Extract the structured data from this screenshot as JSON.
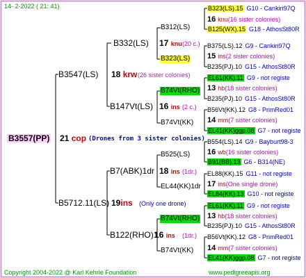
{
  "header": {
    "date": "14-  2-2022 ( 21: 41)"
  },
  "footer": {
    "copyright": "Copyright 2004-2022 @ Karl Kehrle Foundation",
    "site": "www.pedigreeapis.org"
  },
  "root": {
    "code": "B3557(PP)",
    "gen_num": "21",
    "gen_word": "cop",
    "note": "(Drones from 3 sister colonies)"
  },
  "nodes": {
    "b3547": "B3547(LS)",
    "b5712": "B5712.11(LS)",
    "b332": "B332(LS)",
    "b147vt": "B147Vt(LS)",
    "b7abk": "B7(ABK)1dr",
    "b122rho": "B122(RHO)1",
    "b312": "B312(LS)",
    "b323": "B323(LS)",
    "b74vtrho": "B74Vt(RHO)",
    "b74vtkk_a": "B74Vt(KK)",
    "b525": "B525(LS)",
    "el44": "EL44(KK)1dr",
    "b74vtrho2": "B74Vt(RHO)",
    "b74vtkk_b": "B74Vt(KK)"
  },
  "annotations": {
    "n18a": "18",
    "w18a": "krw",
    "c18a": "(26 sister colonies)",
    "n19": "19",
    "w19": "ins",
    "c19": "(Only one drone)",
    "n17": "17",
    "w17": "knu",
    "c17": "(20 c.)",
    "n16": "16",
    "w16": "ins",
    "c16": "(2 c.)",
    "n18b": "18",
    "w18b": "ins",
    "c18b": "(1dr.)",
    "n16b": "16",
    "w16b": "ins",
    "c16b": "(1dr.)"
  },
  "leaves": [
    {
      "kind": "ref",
      "code": "B323(LS).15",
      "hl": "y",
      "tail": "G10 - Cankiri97Q"
    },
    {
      "kind": "info",
      "num": "16",
      "word": "knu",
      "note": "(16 sister colonies)"
    },
    {
      "kind": "ref",
      "code": "B125(WX).15",
      "hl": "y",
      "tail": "G18 - AthosSt80R"
    },
    {
      "kind": "ref",
      "code": "B375(LS).12",
      "hl": "",
      "tail": "G9 - Cankiri97Q"
    },
    {
      "kind": "info",
      "num": "15",
      "word": "ins",
      "note": "(2 sister colonies)"
    },
    {
      "kind": "ref",
      "code": "B235(PJ).10",
      "hl": "",
      "tail": "G15 - AthosSt80R"
    },
    {
      "kind": "ref",
      "code": "EL61(KK).11",
      "hl": "g",
      "tail": "G9 - not registe"
    },
    {
      "kind": "info",
      "num": "13",
      "word": "hb",
      "note": "(18 sister colonies)"
    },
    {
      "kind": "ref",
      "code": "B235(PJ).10",
      "hl": "",
      "tail": "G15 - AthosSt80R"
    },
    {
      "kind": "ref",
      "code": "B56Vt(KK).12",
      "hl": "",
      "tail": "G8 - PrimRed01"
    },
    {
      "kind": "info",
      "num": "14",
      "word": "mm",
      "note": "(7 sister colonies)"
    },
    {
      "kind": "ref",
      "code": "EL41(KK)ggp.08",
      "hl": "g",
      "tail": "G7 - not registe"
    },
    {
      "kind": "ref",
      "code": "B554(LS).14",
      "hl": "",
      "tail": "G9 - Bayburt98-3"
    },
    {
      "kind": "info",
      "num": "16",
      "word": "wb",
      "note": "(16 sister colonies)"
    },
    {
      "kind": "ref",
      "code": "B91(BB).13",
      "hl": "g",
      "tail": "G6 - B314(NE)"
    },
    {
      "kind": "ref",
      "code": "EL88(KK).15",
      "hl": "",
      "tail": "G11 - not registe"
    },
    {
      "kind": "info",
      "num": "17",
      "word": "ins",
      "note": "(One single drone)"
    },
    {
      "kind": "ref",
      "code": "EL84(KK).13",
      "hl": "g",
      "tail": "G10 - not registe"
    },
    {
      "kind": "ref",
      "code": "EL61(KK).11",
      "hl": "g",
      "tail": "G9 - not registe"
    },
    {
      "kind": "info",
      "num": "13",
      "word": "hb",
      "note": "(18 sister colonies)"
    },
    {
      "kind": "ref",
      "code": "B235(PJ).10",
      "hl": "",
      "tail": "G15 - AthosSt80R"
    },
    {
      "kind": "ref",
      "code": "B56Vt(KK).12",
      "hl": "",
      "tail": "G8 - PrimRed01"
    },
    {
      "kind": "info",
      "num": "14",
      "word": "mm",
      "note": "(7 sister colonies)"
    },
    {
      "kind": "ref",
      "code": "EL41(KK)ggp.08",
      "hl": "g",
      "tail": "G7 - not registe"
    }
  ],
  "colors": {
    "frame": "#cc99cc",
    "lines": "#000000",
    "highlight_yellow": "#ffff33",
    "highlight_green": "#00dd00",
    "root_bg": "#ffccff"
  }
}
